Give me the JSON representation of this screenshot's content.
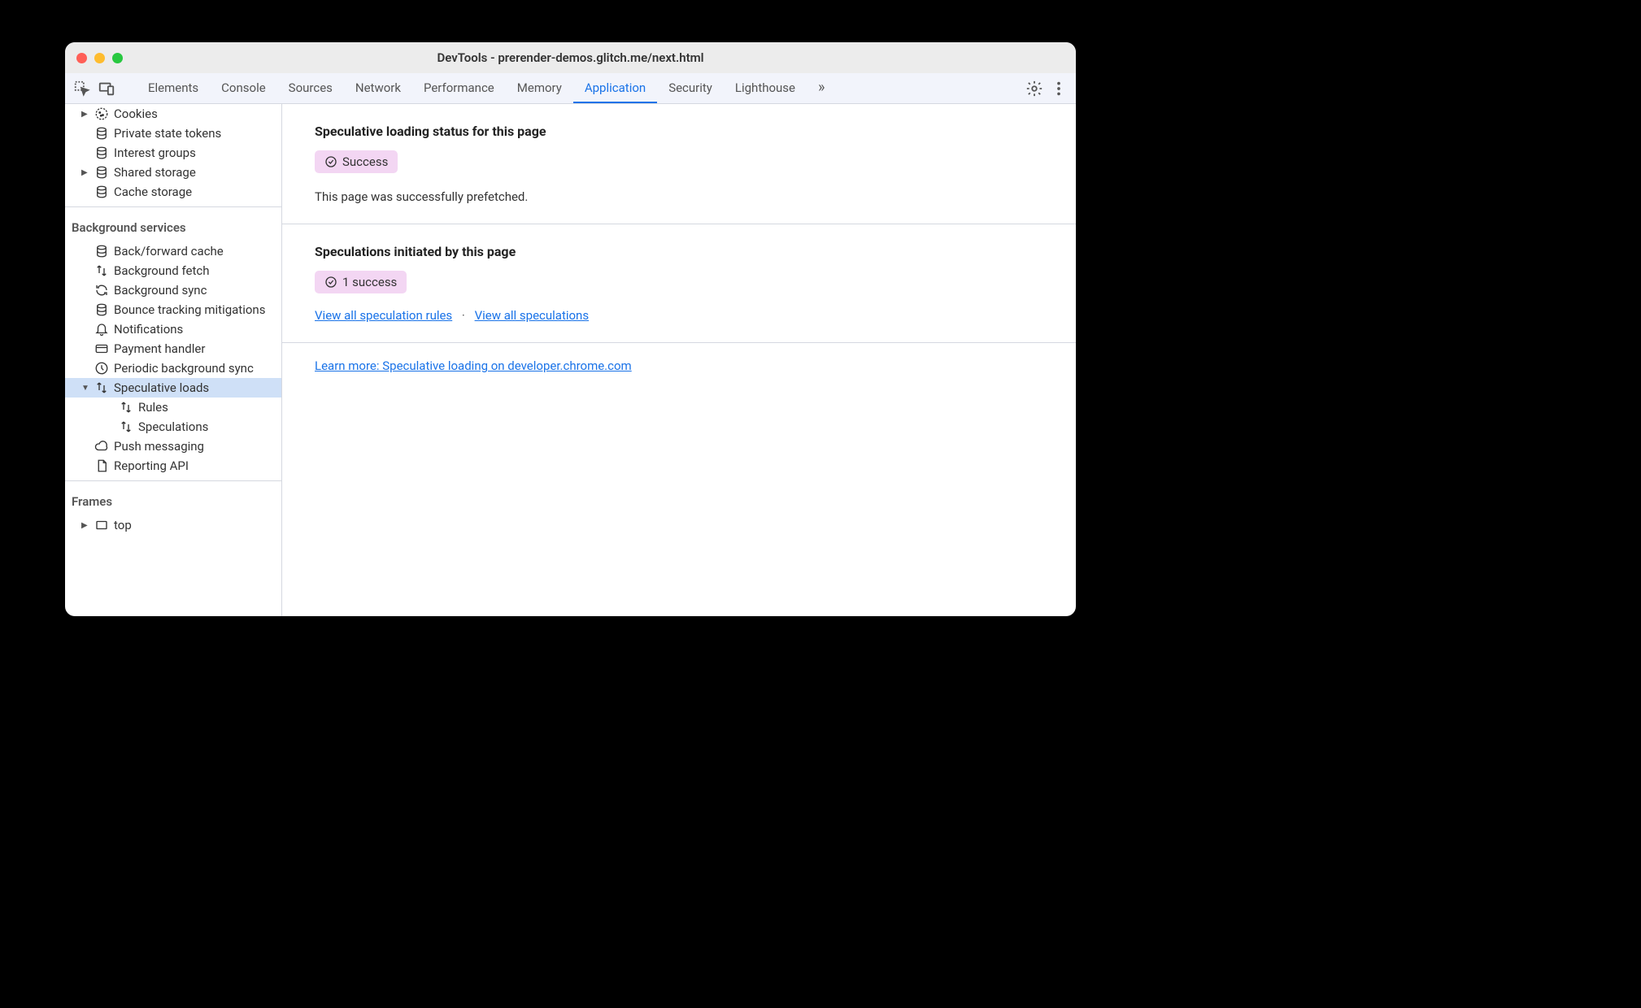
{
  "window": {
    "title": "DevTools - prerender-demos.glitch.me/next.html"
  },
  "tabs": [
    "Elements",
    "Console",
    "Sources",
    "Network",
    "Performance",
    "Memory",
    "Application",
    "Security",
    "Lighthouse"
  ],
  "activeTab": "Application",
  "sidebar": {
    "group1": [
      {
        "label": "Cookies",
        "icon": "cookie",
        "arrow": "right"
      },
      {
        "label": "Private state tokens",
        "icon": "db",
        "arrow": "none"
      },
      {
        "label": "Interest groups",
        "icon": "db",
        "arrow": "none"
      },
      {
        "label": "Shared storage",
        "icon": "db",
        "arrow": "right"
      },
      {
        "label": "Cache storage",
        "icon": "db",
        "arrow": "none"
      }
    ],
    "section2": "Background services",
    "group2": [
      {
        "label": "Back/forward cache",
        "icon": "db",
        "arrow": "none"
      },
      {
        "label": "Background fetch",
        "icon": "updown",
        "arrow": "none"
      },
      {
        "label": "Background sync",
        "icon": "sync",
        "arrow": "none"
      },
      {
        "label": "Bounce tracking mitigations",
        "icon": "db",
        "arrow": "none"
      },
      {
        "label": "Notifications",
        "icon": "bell",
        "arrow": "none"
      },
      {
        "label": "Payment handler",
        "icon": "card",
        "arrow": "none"
      },
      {
        "label": "Periodic background sync",
        "icon": "clock",
        "arrow": "none"
      },
      {
        "label": "Speculative loads",
        "icon": "updown",
        "arrow": "down",
        "selected": true
      },
      {
        "label": "Rules",
        "icon": "updown",
        "arrow": "none",
        "indent": 2
      },
      {
        "label": "Speculations",
        "icon": "updown",
        "arrow": "none",
        "indent": 2
      },
      {
        "label": "Push messaging",
        "icon": "cloud",
        "arrow": "none"
      },
      {
        "label": "Reporting API",
        "icon": "doc",
        "arrow": "none"
      }
    ],
    "section3": "Frames",
    "group3": [
      {
        "label": "top",
        "icon": "frame",
        "arrow": "right"
      }
    ]
  },
  "panel": {
    "status": {
      "heading": "Speculative loading status for this page",
      "badge": "Success",
      "text": "This page was successfully prefetched."
    },
    "initiated": {
      "heading": "Speculations initiated by this page",
      "badge": "1 success",
      "link1": "View all speculation rules",
      "link2": "View all speculations"
    },
    "learn": "Learn more: Speculative loading on developer.chrome.com"
  }
}
